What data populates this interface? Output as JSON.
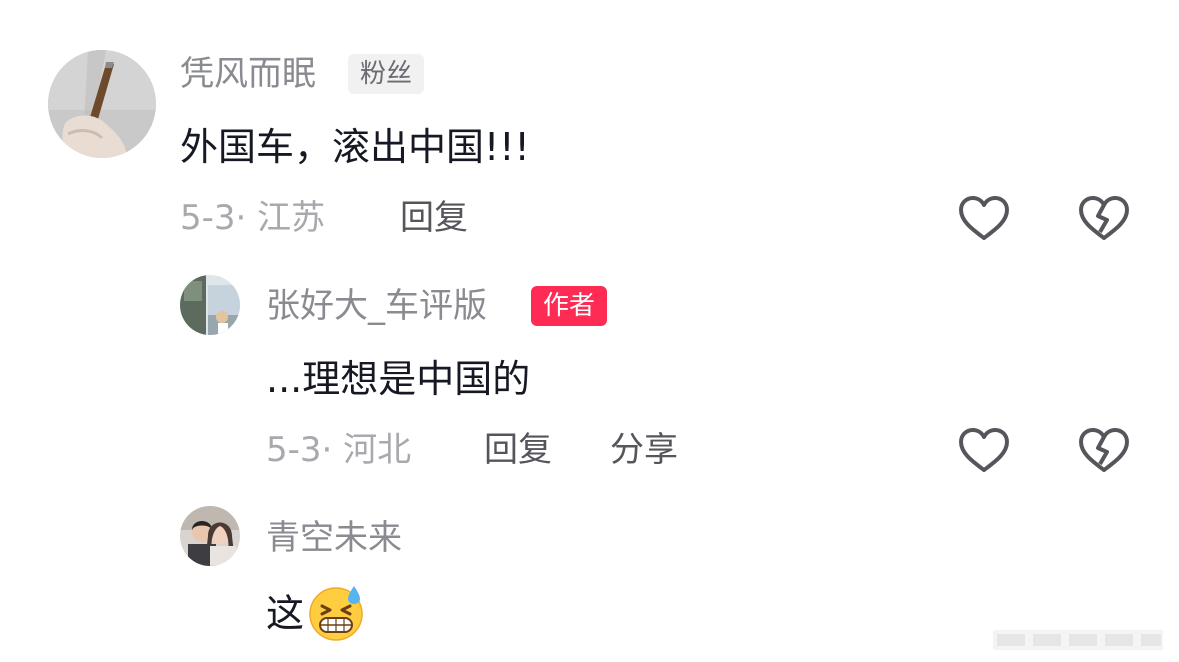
{
  "comments": [
    {
      "username": "凭风而眠",
      "badge": "粉丝",
      "text": "外国车，滚出中国!!!",
      "meta": "5-3· 江苏",
      "reply_label": "回复"
    },
    {
      "username": "张好大_车评版",
      "badge": "作者",
      "text": "...理想是中国的",
      "meta": "5-3· 河北",
      "reply_label": "回复",
      "share_label": "分享"
    },
    {
      "username": "青空未来",
      "text": "这",
      "emoji": "grinning-sweat-emoji"
    }
  ],
  "icons": {
    "like": "heart-outline-icon",
    "dislike": "broken-heart-icon"
  },
  "colors": {
    "author_badge": "#fe2c55",
    "username": "#8a8b91",
    "meta": "#a8a9ae",
    "text": "#161823"
  }
}
